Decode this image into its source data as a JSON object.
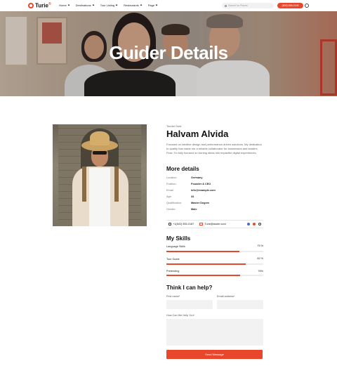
{
  "nav": {
    "logo_text": "Turie",
    "logo_sup": "®",
    "menu": [
      "Home",
      "Destinations",
      "Tour Listing",
      "Restaurants",
      "Page"
    ],
    "search_placeholder": "Search for Places",
    "phone_button": "(800) 555-0199",
    "accent_color": "#e8472b"
  },
  "hero": {
    "title": "Guider Details"
  },
  "profile": {
    "subtitle": "Tourist Guid",
    "name": "Halvam Alvida",
    "bio": "Focused on intuitive design and performance-driven solutions. My dedication to quality has made me a reliable collaborator for businesses and leaders Flow. I'm fully focused on turning ideas into impactful digital experiences."
  },
  "details": {
    "heading": "More details",
    "rows": [
      {
        "key": "Location:",
        "value": "Germany"
      },
      {
        "key": "Position:",
        "value": "Founder & CEO"
      },
      {
        "key": "Email:",
        "value": "info@example.com"
      },
      {
        "key": "Age:",
        "value": "34"
      },
      {
        "key": "Qualification:",
        "value": "Master Degree"
      },
      {
        "key": "Gender:",
        "value": "Male"
      }
    ]
  },
  "contact": {
    "phone": "+1(602) 555-0187",
    "email": "Turie@sisder.com",
    "social_icons": [
      "facebook-icon",
      "x-icon",
      "instagram-icon"
    ]
  },
  "skills": {
    "heading": "My Skills",
    "items": [
      {
        "label": "Language Skills",
        "value": "75 %",
        "percent": 75
      },
      {
        "label": "Tour Guide",
        "value": "82 %",
        "percent": 82
      },
      {
        "label": "Pretending",
        "value": "76%",
        "percent": 76
      }
    ]
  },
  "form": {
    "heading": "Think I can help?",
    "full_name_label": "First name*",
    "email_label": "Email address*",
    "message_label": "How Can We Help You*",
    "submit_label": "Send Message"
  }
}
